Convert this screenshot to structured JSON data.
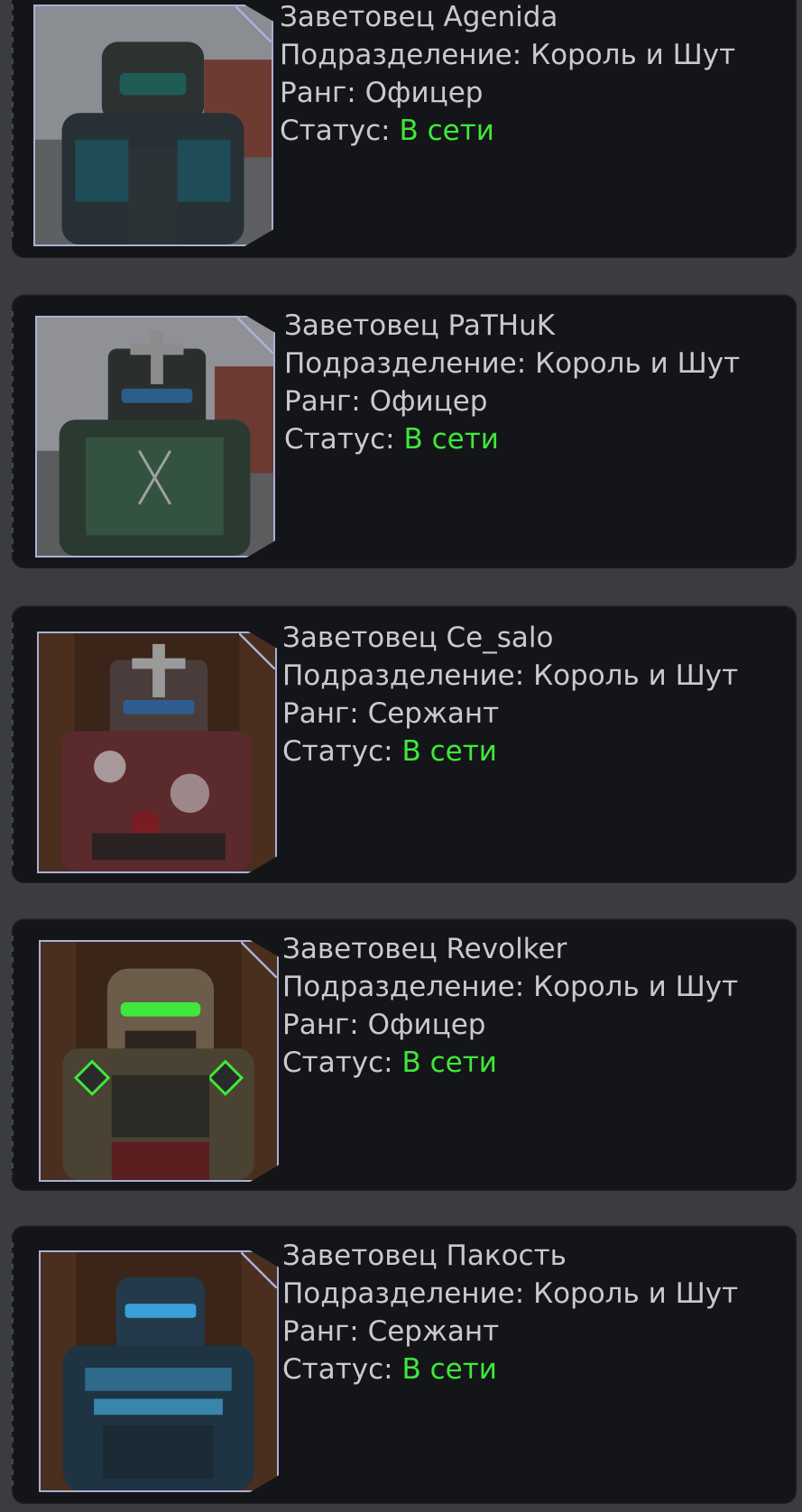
{
  "members": [
    {
      "name": "Заветовец Agenida",
      "division_label": "Подразделение:",
      "division": "Король и Шут",
      "rank_label": "Ранг:",
      "rank": "Офицер",
      "status_label": "Статус:",
      "status": "В сети",
      "portrait_icon": "armored-soldier-portrait-outdoor"
    },
    {
      "name": "Заветовец PaTHuK",
      "division_label": "Подразделение:",
      "division": "Король и Шут",
      "rank_label": "Ранг:",
      "rank": "Офицер",
      "status_label": "Статус:",
      "status": "В сети",
      "portrait_icon": "armored-soldier-portrait-outdoor"
    },
    {
      "name": "Заветовец Ce_salo",
      "division_label": "Подразделение:",
      "division": "Король и Шут",
      "rank_label": "Ранг:",
      "rank": "Сержант",
      "status_label": "Статус:",
      "status": "В сети",
      "portrait_icon": "armored-soldier-portrait-indoor"
    },
    {
      "name": "Заветовец Revolker",
      "division_label": "Подразделение:",
      "division": "Король и Шут",
      "rank_label": "Ранг:",
      "rank": "Офицер",
      "status_label": "Статус:",
      "status": "В сети",
      "portrait_icon": "armored-soldier-portrait-indoor"
    },
    {
      "name": "Заветовец Пакость",
      "division_label": "Подразделение:",
      "division": "Король и Шут",
      "rank_label": "Ранг:",
      "rank": "Сержант",
      "status_label": "Статус:",
      "status": "В сети",
      "portrait_icon": "armored-soldier-portrait-indoor"
    }
  ],
  "colors": {
    "online": "#3fe83a",
    "text": "#c9cace",
    "card_bg": "#141518",
    "page_bg": "#3a3c42",
    "frame": "#aab0d6"
  }
}
